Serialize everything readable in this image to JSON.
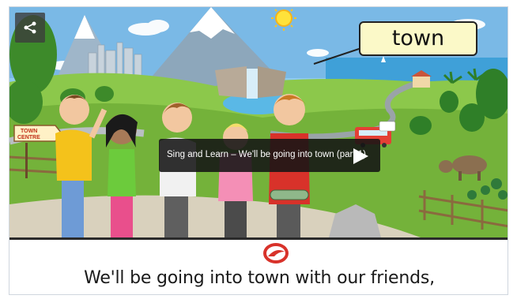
{
  "video": {
    "title": "Sing and Learn – We'll be going into town (part 1)",
    "play_icon": "play-icon",
    "share_icon": "share-icon"
  },
  "scene": {
    "word_card": "town",
    "sign_line1": "TOWN",
    "sign_line2": "CENTRE"
  },
  "caption": {
    "text": "We'll be going into town with our friends,"
  },
  "colors": {
    "accent_red": "#d8322a",
    "sky": "#8fc9ee",
    "grass": "#7dbb3b"
  }
}
